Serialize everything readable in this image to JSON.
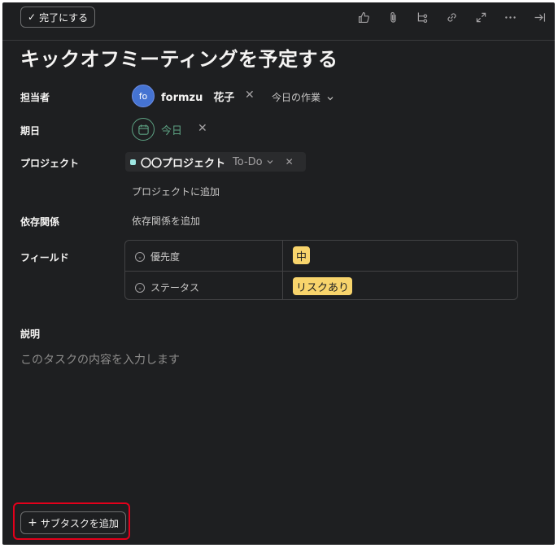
{
  "toolbar": {
    "complete_label": "完了にする",
    "icons": [
      "thumbs-up-icon",
      "paperclip-icon",
      "subtask-icon",
      "link-icon",
      "expand-icon",
      "more-icon",
      "close-panel-icon"
    ]
  },
  "task": {
    "title": "キックオフミーティングを予定する"
  },
  "assignee": {
    "label": "担当者",
    "initials": "fo",
    "name": "formzu　花子",
    "remove": "✕",
    "today_work": "今日の作業"
  },
  "due": {
    "label": "期日",
    "value": "今日",
    "remove": "✕"
  },
  "project": {
    "label": "プロジェクト",
    "name": "〇〇プロジェクト",
    "section": "To-Do",
    "remove": "✕",
    "add_link": "プロジェクトに追加"
  },
  "dependencies": {
    "label": "依存関係",
    "add_link": "依存関係を追加"
  },
  "fields": {
    "label": "フィールド",
    "rows": [
      {
        "name": "優先度",
        "value": "中"
      },
      {
        "name": "ステータス",
        "value": "リスクあり"
      }
    ]
  },
  "description": {
    "label": "説明",
    "placeholder": "このタスクの内容を入力します"
  },
  "subtask": {
    "add_label": "サブタスクを追加"
  },
  "colors": {
    "background": "#1e1f21",
    "due_green": "#5da283",
    "field_value_yellow": "#f8d46c",
    "highlight_red": "#e3001b",
    "avatar_blue": "#4573d2"
  }
}
